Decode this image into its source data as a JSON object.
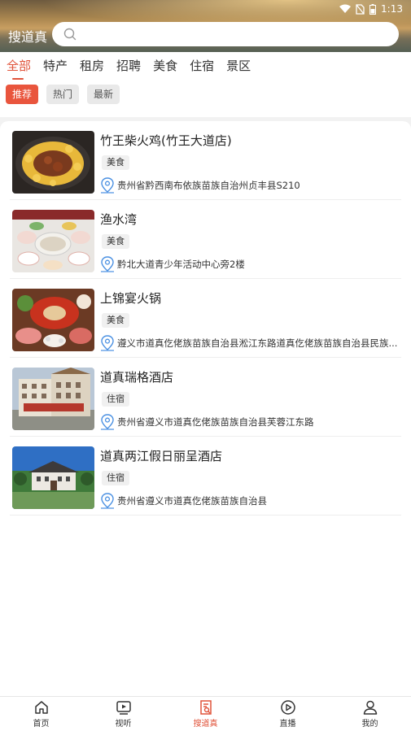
{
  "status_bar": {
    "time": "1:13"
  },
  "header": {
    "brand": "搜道真",
    "search_placeholder": ""
  },
  "tabs": [
    "全部",
    "特产",
    "租房",
    "招聘",
    "美食",
    "住宿",
    "景区"
  ],
  "sort_chips": [
    "推荐",
    "热门",
    "最新"
  ],
  "listings": [
    {
      "title": "竹王柴火鸡(竹王大道店)",
      "tag": "美食",
      "address": "贵州省黔西南布依族苗族自治州贞丰县S210"
    },
    {
      "title": "渔水湾",
      "tag": "美食",
      "address": "黔北大道青少年活动中心旁2楼"
    },
    {
      "title": "上锦宴火锅",
      "tag": "美食",
      "address": "遵义市道真仡佬族苗族自治县淞江东路道真仡佬族苗族自治县民族..."
    },
    {
      "title": "道真瑞格酒店",
      "tag": "住宿",
      "address": "贵州省遵义市道真仡佬族苗族自治县芙蓉江东路"
    },
    {
      "title": "道真两江假日丽呈酒店",
      "tag": "住宿",
      "address": "贵州省遵义市道真仡佬族苗族自治县"
    }
  ],
  "bottom_nav": [
    {
      "label": "首页",
      "icon": "home-icon"
    },
    {
      "label": "视听",
      "icon": "video-icon"
    },
    {
      "label": "搜道真",
      "icon": "search-doc-icon"
    },
    {
      "label": "直播",
      "icon": "play-circle-icon"
    },
    {
      "label": "我的",
      "icon": "user-icon"
    }
  ],
  "colors": {
    "accent": "#e0533a",
    "chip_active": "#e9553d",
    "pin": "#4a90e2"
  }
}
